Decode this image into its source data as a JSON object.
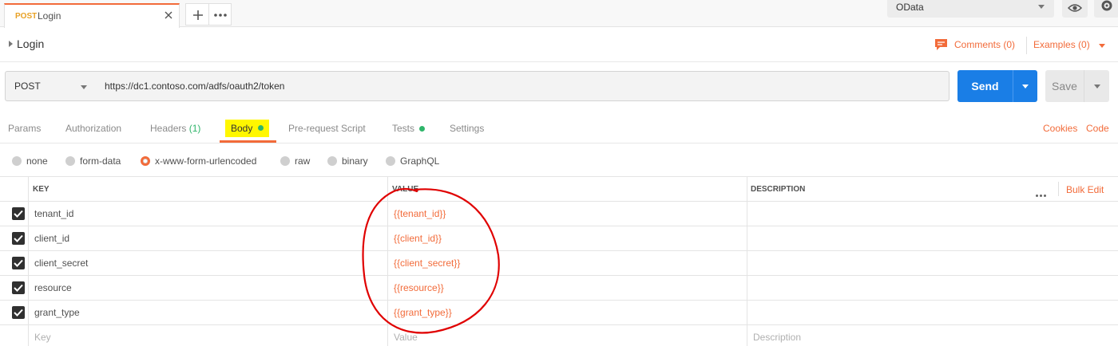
{
  "tab": {
    "method": "POST",
    "name": "Login"
  },
  "environment": {
    "selected": "OData"
  },
  "request": {
    "name": "Login",
    "method": "POST",
    "url": "https://dc1.contoso.com/adfs/oauth2/token"
  },
  "header_links": {
    "comments": "Comments (0)",
    "examples": "Examples (0)"
  },
  "buttons": {
    "send": "Send",
    "save": "Save"
  },
  "subtabs": {
    "params": "Params",
    "authorization": "Authorization",
    "headers": "Headers",
    "headers_count": "(1)",
    "body": "Body",
    "pre_request": "Pre-request Script",
    "tests": "Tests",
    "settings": "Settings",
    "cookies": "Cookies",
    "code": "Code"
  },
  "body_types": {
    "none": "none",
    "form_data": "form-data",
    "urlencoded": "x-www-form-urlencoded",
    "raw": "raw",
    "binary": "binary",
    "graphql": "GraphQL",
    "selected": "x-www-form-urlencoded"
  },
  "table": {
    "headers": {
      "key": "KEY",
      "value": "VALUE",
      "description": "DESCRIPTION",
      "bulk_edit": "Bulk Edit"
    },
    "rows": [
      {
        "key": "tenant_id",
        "value": "{{tenant_id}}",
        "checked": true
      },
      {
        "key": "client_id",
        "value": "{{client_id}}",
        "checked": true
      },
      {
        "key": "client_secret",
        "value": "{{client_secret}}",
        "checked": true
      },
      {
        "key": "resource",
        "value": "{{resource}}",
        "checked": true
      },
      {
        "key": "grant_type",
        "value": "{{grant_type}}",
        "checked": true
      }
    ],
    "placeholders": {
      "key": "Key",
      "value": "Value",
      "description": "Description"
    }
  },
  "colors": {
    "accent": "#f26b3a",
    "send": "#1a7ee6",
    "status_dot": "#2eb56a",
    "highlight": "#fff700",
    "annotation": "#e00000"
  }
}
